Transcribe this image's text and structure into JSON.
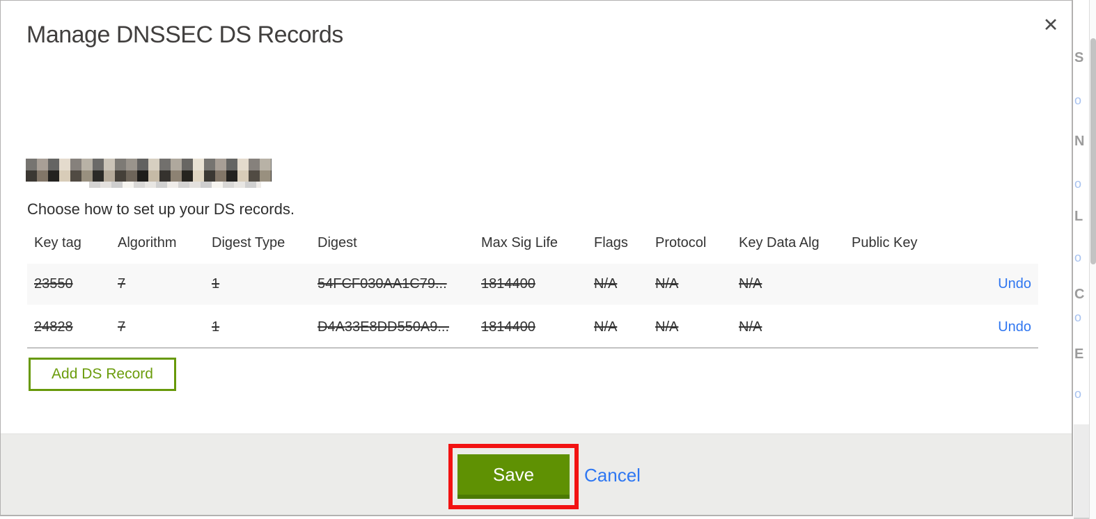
{
  "modal": {
    "title": "Manage DNSSEC DS Records",
    "close_icon": "✕",
    "instruction": "Choose how to set up your DS records.",
    "add_ds_record_label": "Add DS Record",
    "save_label": "Save",
    "cancel_label": "Cancel"
  },
  "table": {
    "headers": [
      "Key tag",
      "Algorithm",
      "Digest Type",
      "Digest",
      "Max Sig Life",
      "Flags",
      "Protocol",
      "Key Data Alg",
      "Public Key"
    ],
    "rows": [
      {
        "key_tag": "23550",
        "algorithm": "7",
        "digest_type": "1",
        "digest": "54FCF030AA1C79...",
        "max_sig_life": "1814400",
        "flags": "N/A",
        "protocol": "N/A",
        "key_data_alg": "N/A",
        "public_key": "",
        "undo_label": "Undo",
        "state": "marked-for-deletion"
      },
      {
        "key_tag": "24828",
        "algorithm": "7",
        "digest_type": "1",
        "digest": "D4A33E8DD550A9...",
        "max_sig_life": "1814400",
        "flags": "N/A",
        "protocol": "N/A",
        "key_data_alg": "N/A",
        "public_key": "",
        "undo_label": "Undo",
        "state": "marked-for-deletion"
      }
    ]
  },
  "colors": {
    "accent_green": "#5f9103",
    "accent_green_dark": "#4b7a02",
    "outline_green": "#68990a",
    "link_blue": "#2f76f0",
    "annotation_red": "#f21212",
    "footer_gray": "#ececea",
    "row_stripe": "#f8f8f8"
  },
  "page_behind": {
    "fragments": [
      "S",
      "o",
      "N",
      "o",
      "L",
      "o",
      "C",
      "o",
      "E",
      "o"
    ]
  }
}
